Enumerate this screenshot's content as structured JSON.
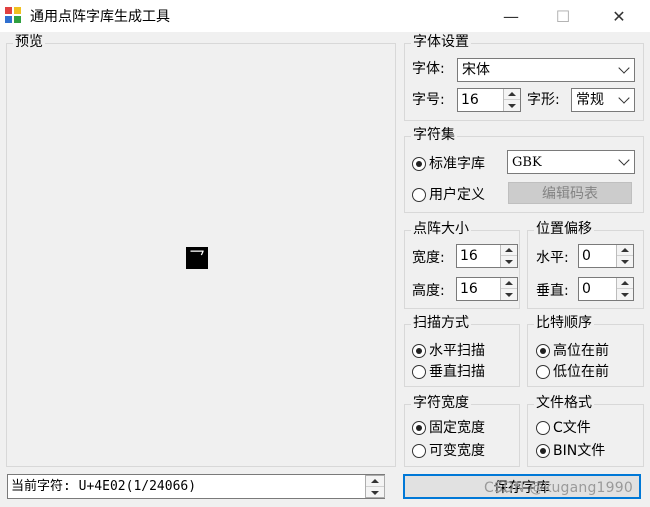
{
  "window": {
    "title": "通用点阵字库生成工具",
    "minimize": "—",
    "maximize": "☐",
    "close": "✕"
  },
  "preview": {
    "label": "预览",
    "glyph": "乛"
  },
  "font_settings": {
    "title": "字体设置",
    "font_label": "字体:",
    "font_value": "宋体",
    "size_label": "字号:",
    "size_value": "16",
    "style_label": "字形:",
    "style_value": "常规"
  },
  "charset": {
    "title": "字符集",
    "standard_label": "标准字库",
    "standard_checked": true,
    "charset_value": "GBK",
    "user_label": "用户定义",
    "user_checked": false,
    "edit_button": "编辑码表"
  },
  "dot_size": {
    "title": "点阵大小",
    "width_label": "宽度:",
    "width_value": "16",
    "height_label": "高度:",
    "height_value": "16"
  },
  "offset": {
    "title": "位置偏移",
    "h_label": "水平:",
    "h_value": "0",
    "v_label": "垂直:",
    "v_value": "0"
  },
  "scan_mode": {
    "title": "扫描方式",
    "options": [
      {
        "label": "水平扫描",
        "checked": true
      },
      {
        "label": "垂直扫描",
        "checked": false
      }
    ]
  },
  "bit_order": {
    "title": "比特顺序",
    "options": [
      {
        "label": "高位在前",
        "checked": true
      },
      {
        "label": "低位在前",
        "checked": false
      }
    ]
  },
  "char_width": {
    "title": "字符宽度",
    "options": [
      {
        "label": "固定宽度",
        "checked": true
      },
      {
        "label": "可变宽度",
        "checked": false
      }
    ]
  },
  "file_format": {
    "title": "文件格式",
    "options": [
      {
        "label": "C文件",
        "checked": false
      },
      {
        "label": "BIN文件",
        "checked": true
      }
    ]
  },
  "status": {
    "current_char": "当前字符: U+4E02(1/24066)"
  },
  "save_button": "保存字库",
  "watermark": "CSDN @kugang1990"
}
